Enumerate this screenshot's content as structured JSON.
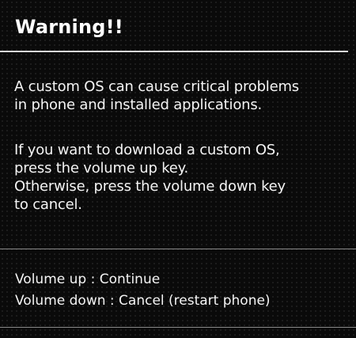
{
  "title": "Warning!!",
  "message": {
    "paragraph1": [
      "A custom OS can cause critical problems",
      "in phone and installed applications."
    ],
    "paragraph2": [
      "If you want to download a custom OS,",
      "press the volume up key.",
      "Otherwise, press the volume down key",
      "to cancel."
    ]
  },
  "options": {
    "volume_up": "Volume up : Continue",
    "volume_down": "Volume down : Cancel (restart phone)"
  }
}
